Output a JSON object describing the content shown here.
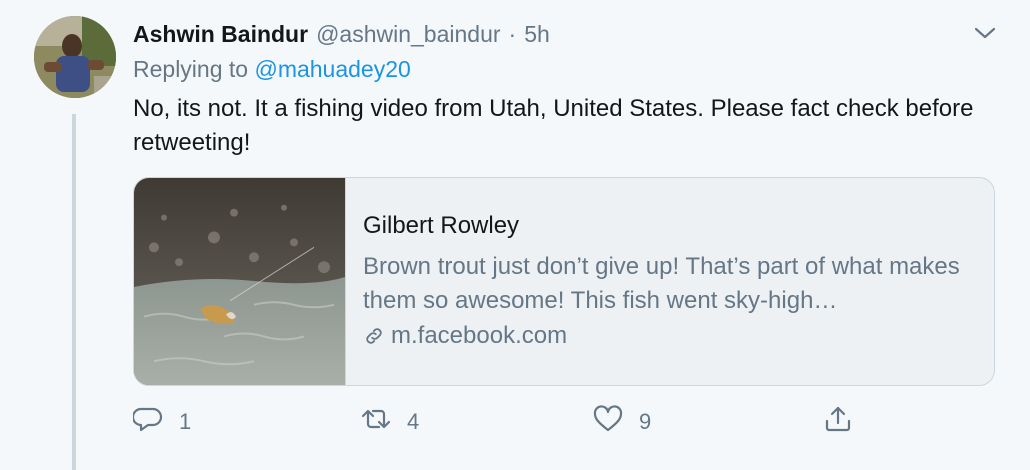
{
  "author": {
    "name": "Ashwin Baindur",
    "handle": "@ashwin_baindur",
    "separator": "·",
    "time": "5h"
  },
  "reply": {
    "prefix": "Replying to",
    "mention": "@mahuadey20"
  },
  "tweet_text": "No, its not. It a fishing video from Utah, United States. Please fact check before retweeting!",
  "card": {
    "title": "Gilbert Rowley",
    "description": "Brown trout just don’t give up! That’s part of what makes them so awesome! This fish went sky-high…",
    "domain": "m.facebook.com"
  },
  "actions": {
    "reply_count": "1",
    "retweet_count": "4",
    "like_count": "9"
  },
  "icons": [
    "chevron-down-icon",
    "link-icon",
    "reply-icon",
    "retweet-icon",
    "like-icon",
    "share-icon"
  ],
  "colors": {
    "background": "#f5f8fa",
    "mention": "#1b95e0",
    "secondary_text": "#657786",
    "border": "#ccd6dd"
  }
}
